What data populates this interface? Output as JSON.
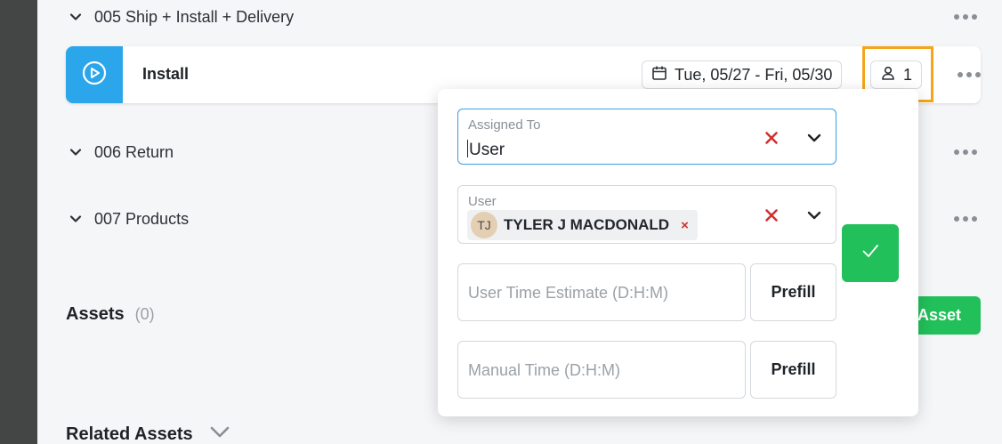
{
  "sections": [
    {
      "label": "005 Ship + Install + Delivery"
    },
    {
      "label": "006 Return"
    },
    {
      "label": "007 Products"
    }
  ],
  "task": {
    "name": "Install",
    "date_range": "Tue, 05/27 - Fri, 05/30",
    "assignee_count": "1"
  },
  "assets": {
    "title": "Assets",
    "count": "(0)",
    "add_button_label": "Asset"
  },
  "related_assets": {
    "title": "Related Assets"
  },
  "popover": {
    "assigned_to": {
      "label": "Assigned To",
      "value": "User"
    },
    "user": {
      "label": "User",
      "chip_initials": "TJ",
      "chip_name": "TYLER J MACDONALD",
      "chip_remove": "×"
    },
    "user_time_estimate": {
      "placeholder": "User Time Estimate (D:H:M)",
      "prefill_label": "Prefill"
    },
    "manual_time": {
      "placeholder": "Manual Time (D:H:M)",
      "prefill_label": "Prefill"
    }
  },
  "colors": {
    "accent_blue": "#2ba6ea",
    "success_green": "#22c05a",
    "highlight_orange": "#f4a51c",
    "danger_red": "#d32f2f"
  },
  "icons": [
    "chevron-down-icon",
    "play-circle-icon",
    "calendar-icon",
    "user-icon",
    "more-dots-icon",
    "close-x-icon",
    "checkmark-icon"
  ]
}
